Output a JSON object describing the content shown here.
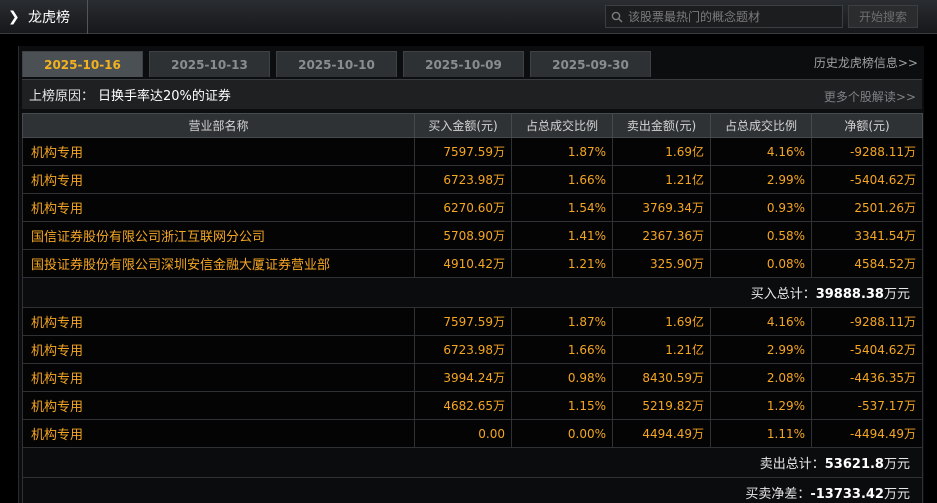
{
  "header": {
    "title": "龙虎榜",
    "search_placeholder": "该股票最热门的概念题材",
    "search_button": "开始搜索"
  },
  "tabs": [
    {
      "label": "2025-10-16",
      "active": true
    },
    {
      "label": "2025-10-13",
      "active": false
    },
    {
      "label": "2025-10-10",
      "active": false
    },
    {
      "label": "2025-10-09",
      "active": false
    },
    {
      "label": "2025-09-30",
      "active": false
    }
  ],
  "history_link": "历史龙虎榜信息>>",
  "reason": {
    "label": "上榜原因：",
    "value": "日换手率达20%的证券",
    "more_link": "更多个股解读>>"
  },
  "columns": [
    "营业部名称",
    "买入金额(元)",
    "占总成交比例",
    "卖出金额(元)",
    "占总成交比例",
    "净额(元)"
  ],
  "buy_rows": [
    [
      "机构专用",
      "7597.59万",
      "1.87%",
      "1.69亿",
      "4.16%",
      "-9288.11万"
    ],
    [
      "机构专用",
      "6723.98万",
      "1.66%",
      "1.21亿",
      "2.99%",
      "-5404.62万"
    ],
    [
      "机构专用",
      "6270.60万",
      "1.54%",
      "3769.34万",
      "0.93%",
      "2501.26万"
    ],
    [
      "国信证券股份有限公司浙江互联网分公司",
      "5708.90万",
      "1.41%",
      "2367.36万",
      "0.58%",
      "3341.54万"
    ],
    [
      "国投证券股份有限公司深圳安信金融大厦证券营业部",
      "4910.42万",
      "1.21%",
      "325.90万",
      "0.08%",
      "4584.52万"
    ]
  ],
  "buy_total": {
    "label": "买入总计：",
    "value": "39888.38",
    "unit": "万元"
  },
  "sell_rows": [
    [
      "机构专用",
      "7597.59万",
      "1.87%",
      "1.69亿",
      "4.16%",
      "-9288.11万"
    ],
    [
      "机构专用",
      "6723.98万",
      "1.66%",
      "1.21亿",
      "2.99%",
      "-5404.62万"
    ],
    [
      "机构专用",
      "3994.24万",
      "0.98%",
      "8430.59万",
      "2.08%",
      "-4436.35万"
    ],
    [
      "机构专用",
      "4682.65万",
      "1.15%",
      "5219.82万",
      "1.29%",
      "-537.17万"
    ],
    [
      "机构专用",
      "0.00",
      "0.00%",
      "4494.49万",
      "1.11%",
      "-4494.49万"
    ]
  ],
  "sell_total": {
    "label": "卖出总计：",
    "value": "53621.8",
    "unit": "万元"
  },
  "net_diff": {
    "label": "买卖净差：",
    "value": "-13733.42",
    "unit": "万元"
  },
  "colors": {
    "accent": "#f5a623",
    "tab_active_text": "#f3b21e",
    "background": "#000000"
  }
}
